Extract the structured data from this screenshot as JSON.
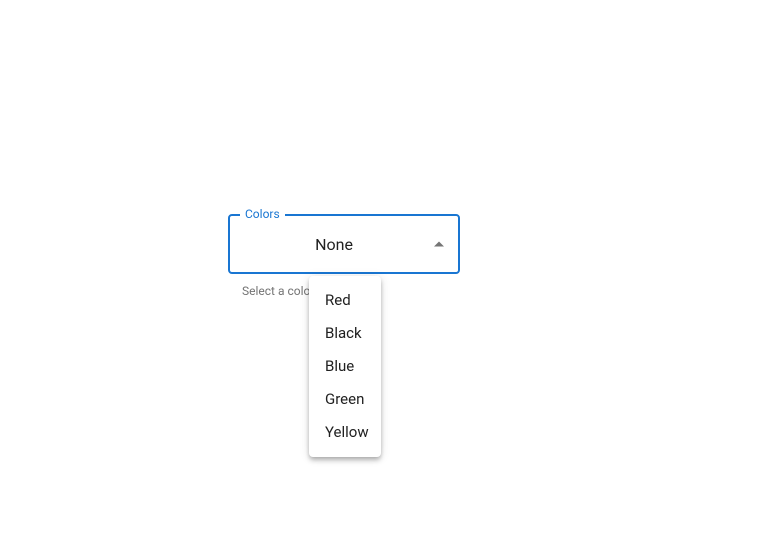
{
  "select": {
    "label": "Colors",
    "value": "None",
    "helper": "Select a color",
    "options": [
      "Red",
      "Black",
      "Blue",
      "Green",
      "Yellow"
    ]
  }
}
